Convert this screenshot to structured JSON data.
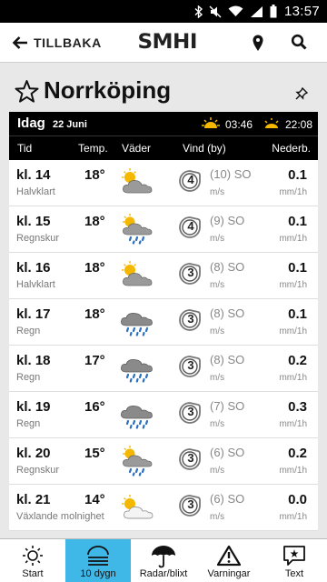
{
  "statusbar": {
    "time": "13:57"
  },
  "appbar": {
    "back_label": "TILLBAKA",
    "logo": "SMHI"
  },
  "city": {
    "name": "Norrköping"
  },
  "day": {
    "label": "Idag",
    "date": "22 Juni",
    "sunrise": "03:46",
    "sunset": "22:08"
  },
  "columns": {
    "time": "Tid",
    "temp": "Temp.",
    "weather": "Väder",
    "wind": "Vind (by)",
    "precip": "Nederb."
  },
  "rows": [
    {
      "hour": "kl. 14",
      "desc": "Halvklart",
      "temp": "18°",
      "icon": "partly-cloudy-icon",
      "wind": "4",
      "gust": "(10) SO",
      "wind_unit": "m/s",
      "precip": "0.1",
      "precip_unit": "mm/1h"
    },
    {
      "hour": "kl. 15",
      "desc": "Regnskur",
      "temp": "18°",
      "icon": "rain-shower-icon",
      "wind": "4",
      "gust": "(9) SO",
      "wind_unit": "m/s",
      "precip": "0.1",
      "precip_unit": "mm/1h"
    },
    {
      "hour": "kl. 16",
      "desc": "Halvklart",
      "temp": "18°",
      "icon": "partly-cloudy-icon",
      "wind": "3",
      "gust": "(8) SO",
      "wind_unit": "m/s",
      "precip": "0.1",
      "precip_unit": "mm/1h"
    },
    {
      "hour": "kl. 17",
      "desc": "Regn",
      "temp": "18°",
      "icon": "rain-icon",
      "wind": "3",
      "gust": "(8) SO",
      "wind_unit": "m/s",
      "precip": "0.1",
      "precip_unit": "mm/1h"
    },
    {
      "hour": "kl. 18",
      "desc": "Regn",
      "temp": "17°",
      "icon": "rain-icon",
      "wind": "3",
      "gust": "(8) SO",
      "wind_unit": "m/s",
      "precip": "0.2",
      "precip_unit": "mm/1h"
    },
    {
      "hour": "kl. 19",
      "desc": "Regn",
      "temp": "16°",
      "icon": "rain-icon",
      "wind": "3",
      "gust": "(7) SO",
      "wind_unit": "m/s",
      "precip": "0.3",
      "precip_unit": "mm/1h"
    },
    {
      "hour": "kl. 20",
      "desc": "Regnskur",
      "temp": "15°",
      "icon": "rain-shower-icon",
      "wind": "3",
      "gust": "(6) SO",
      "wind_unit": "m/s",
      "precip": "0.2",
      "precip_unit": "mm/1h"
    },
    {
      "hour": "kl. 21",
      "desc": "Växlande molnighet",
      "temp": "14°",
      "icon": "variable-cloud-icon",
      "wind": "3",
      "gust": "(6) SO",
      "wind_unit": "m/s",
      "precip": "0.0",
      "precip_unit": "mm/1h"
    }
  ],
  "tabs": [
    {
      "label": "Start",
      "icon": "sun-icon",
      "active": false
    },
    {
      "label": "10 dygn",
      "icon": "ten-days-icon",
      "active": true
    },
    {
      "label": "Radar/blixt",
      "icon": "umbrella-icon",
      "active": false
    },
    {
      "label": "Varningar",
      "icon": "warning-icon",
      "active": false
    },
    {
      "label": "Text",
      "icon": "text-bubble-icon",
      "active": false
    }
  ],
  "colors": {
    "active_tab": "#3fb8e8",
    "header_bg": "#000000",
    "sun": "#f5b800"
  }
}
